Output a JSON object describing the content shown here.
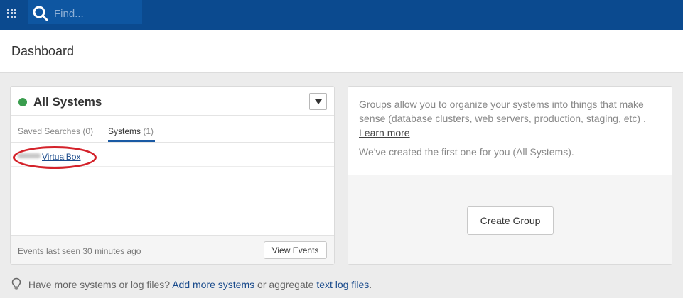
{
  "topbar": {
    "apps_icon": "apps-grid-icon",
    "search_icon": "search-icon",
    "search_placeholder": "Find..."
  },
  "header": {
    "title": "Dashboard"
  },
  "systems_card": {
    "title": "All Systems",
    "status_color": "#3a9d4e",
    "tabs": [
      {
        "label": "Saved Searches",
        "count": "(0)",
        "active": false
      },
      {
        "label": "Systems",
        "count": "(1)",
        "active": true
      }
    ],
    "systems": [
      {
        "name": "VirtualBox"
      }
    ],
    "footer_text": "Events last seen 30 minutes ago",
    "view_events_label": "View Events"
  },
  "groups_card": {
    "description": "Groups allow you to organize your systems into things that make sense (database clusters, web servers, production, staging, etc) .",
    "learn_more": "Learn more",
    "created_note": "We've created the first one for you (All Systems).",
    "create_group_label": "Create Group"
  },
  "bottom_note": {
    "icon": "lightbulb-icon",
    "prefix": "Have more systems or log files?",
    "link1": "Add more systems",
    "middle": "or aggregate",
    "link2": "text log files",
    "suffix": "."
  },
  "colors": {
    "topbar": "#0b4a8f",
    "accent": "#1a5aa4",
    "annotation": "#d4222a"
  }
}
